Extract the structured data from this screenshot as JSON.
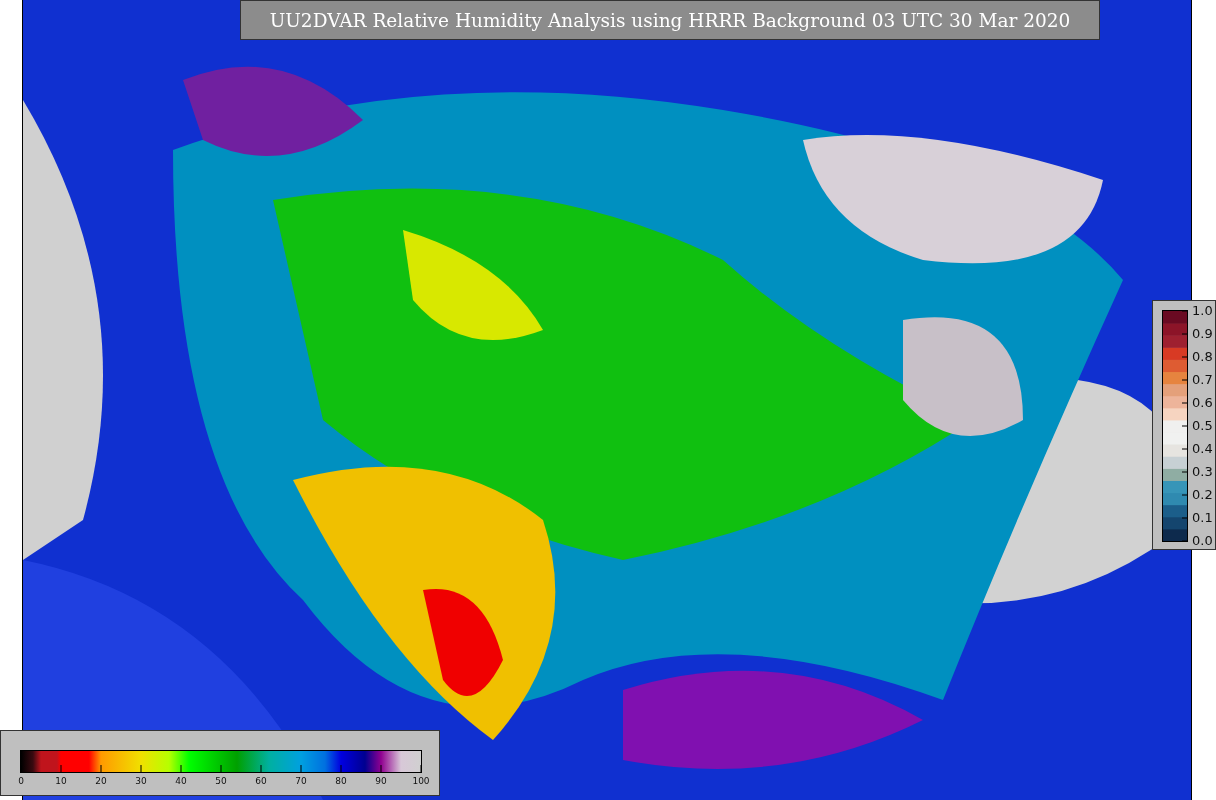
{
  "title": "UU2DVAR Relative Humidity Analysis using HRRR Background 03 UTC 30 Mar 2020",
  "right_colorbar": {
    "ticks": [
      "1.0",
      "0.9",
      "0.8",
      "0.7",
      "0.6",
      "0.5",
      "0.4",
      "0.3",
      "0.2",
      "0.1",
      "0.0"
    ]
  },
  "bottom_colorbar": {
    "ticks": [
      "0",
      "10",
      "20",
      "30",
      "40",
      "50",
      "60",
      "70",
      "80",
      "90",
      "100"
    ]
  }
}
